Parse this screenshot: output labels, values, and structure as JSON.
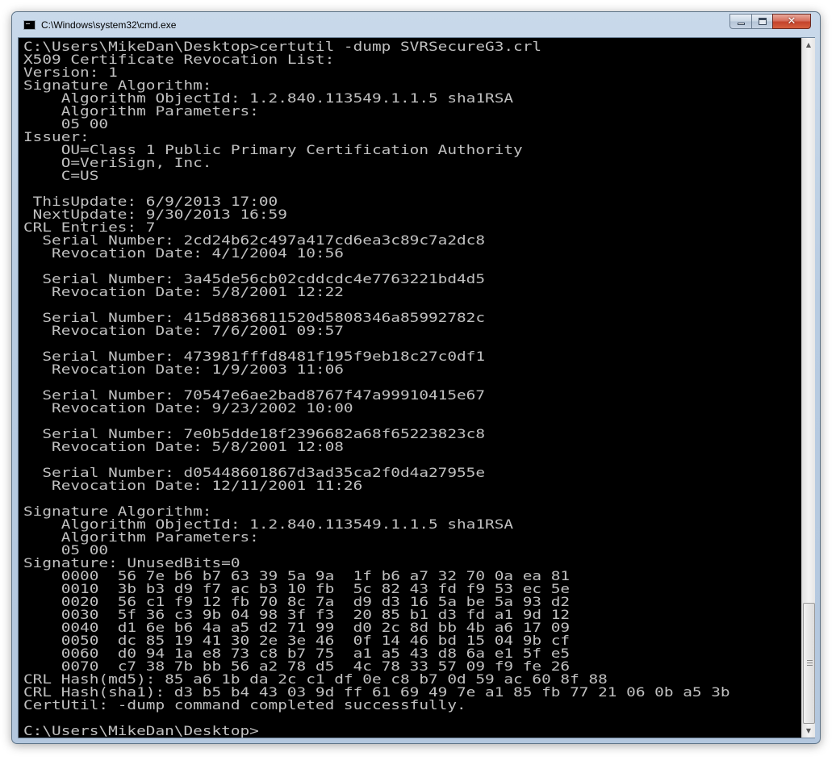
{
  "window": {
    "title": "C:\\Windows\\system32\\cmd.exe",
    "icon": "cmd-icon",
    "controls": {
      "minimize": "minimize-icon",
      "maximize": "maximize-icon",
      "close": "close-icon",
      "close_glyph": "✕"
    }
  },
  "console": {
    "text_color": "#c0c0c0",
    "background": "#000000",
    "lines": [
      "C:\\Users\\MikeDan\\Desktop>certutil -dump SVRSecureG3.crl",
      "X509 Certificate Revocation List:",
      "Version: 1",
      "Signature Algorithm:",
      "    Algorithm ObjectId: 1.2.840.113549.1.1.5 sha1RSA",
      "    Algorithm Parameters:",
      "    05 00",
      "Issuer:",
      "    OU=Class 1 Public Primary Certification Authority",
      "    O=VeriSign, Inc.",
      "    C=US",
      "",
      " ThisUpdate: 6/9/2013 17:00",
      " NextUpdate: 9/30/2013 16:59",
      "CRL Entries: 7",
      "  Serial Number: 2cd24b62c497a417cd6ea3c89c7a2dc8",
      "   Revocation Date: 4/1/2004 10:56",
      "",
      "  Serial Number: 3a45de56cb02cddcdc4e7763221bd4d5",
      "   Revocation Date: 5/8/2001 12:22",
      "",
      "  Serial Number: 415d8836811520d5808346a85992782c",
      "   Revocation Date: 7/6/2001 09:57",
      "",
      "  Serial Number: 473981fffd8481f195f9eb18c27c0df1",
      "   Revocation Date: 1/9/2003 11:06",
      "",
      "  Serial Number: 70547e6ae2bad8767f47a99910415e67",
      "   Revocation Date: 9/23/2002 10:00",
      "",
      "  Serial Number: 7e0b5dde18f2396682a68f65223823c8",
      "   Revocation Date: 5/8/2001 12:08",
      "",
      "  Serial Number: d05448601867d3ad35ca2f0d4a27955e",
      "   Revocation Date: 12/11/2001 11:26",
      "",
      "Signature Algorithm:",
      "    Algorithm ObjectId: 1.2.840.113549.1.1.5 sha1RSA",
      "    Algorithm Parameters:",
      "    05 00",
      "Signature: UnusedBits=0",
      "    0000  56 7e b6 b7 63 39 5a 9a  1f b6 a7 32 70 0a ea 81",
      "    0010  3b b3 d9 f7 ac b3 10 fb  5c 82 43 fd f9 53 ec 5e",
      "    0020  56 c1 f9 12 fb 70 8c 7a  d9 d3 16 5a be 5a 93 d2",
      "    0030  5f 36 c3 9b 04 98 3f f3  20 85 b1 d3 fd a1 9d 12",
      "    0040  d1 6e b6 4a a5 d2 71 99  d0 2c 8d bb 4b a6 17 09",
      "    0050  dc 85 19 41 30 2e 3e 46  0f 14 46 bd 15 04 9b cf",
      "    0060  d0 94 1a e8 73 c8 b7 75  a1 a5 43 d8 6a e1 5f e5",
      "    0070  c7 38 7b bb 56 a2 78 d5  4c 78 33 57 09 f9 fe 26",
      "CRL Hash(md5): 85 a6 1b da 2c c1 df 0e c8 b7 0d 59 ac 60 8f 88",
      "CRL Hash(sha1): d3 b5 b4 43 03 9d ff 61 69 49 7e a1 85 fb 77 21 06 0b a5 3b",
      "CertUtil: -dump command completed successfully.",
      "",
      "C:\\Users\\MikeDan\\Desktop>"
    ]
  },
  "scrollbar": {
    "up_icon": "▲",
    "down_icon": "▼"
  }
}
